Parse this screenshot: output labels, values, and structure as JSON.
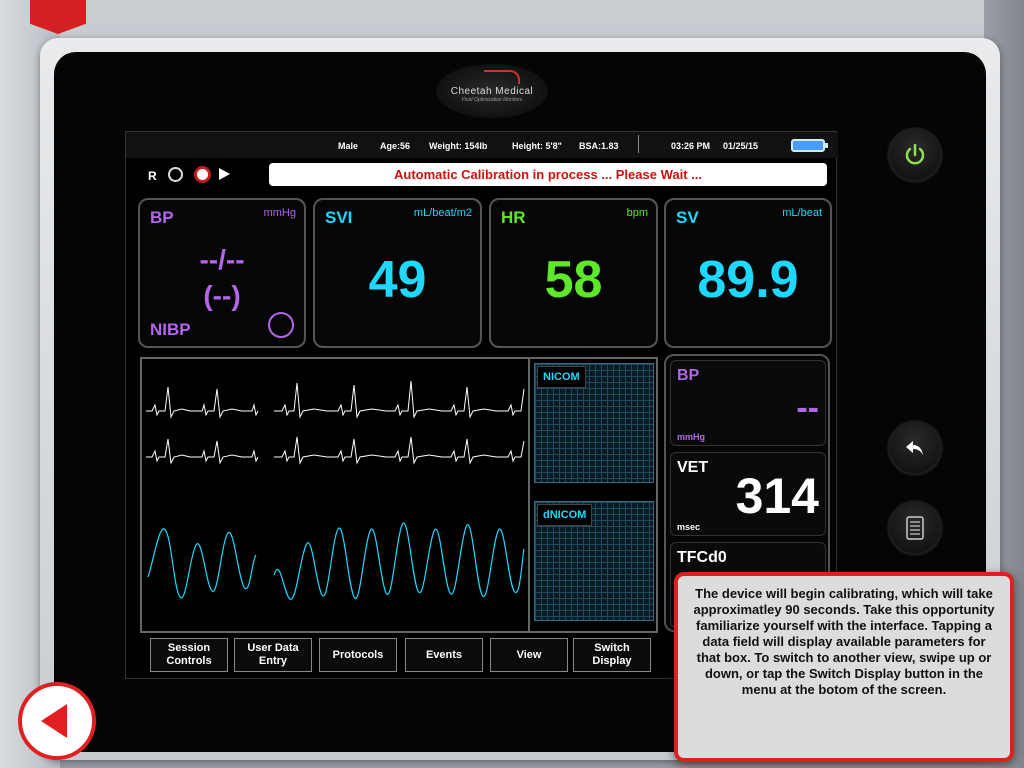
{
  "device": {
    "logo_brand": "Cheetah Medical",
    "logo_tagline": "Fluid Optimization Monitors"
  },
  "header": {
    "gender": "Male",
    "age": "Age:56",
    "weight": "Weight: 154lb",
    "height": "Height: 5'8\"",
    "bsa": "BSA:1.83",
    "time": "03:26 PM",
    "date": "01/25/15"
  },
  "toolbar": {
    "r_label": "R",
    "status_message": "Automatic Calibration in process ... Please Wait ..."
  },
  "tiles": [
    {
      "label": "BP",
      "unit": "mmHg",
      "value": "--/--",
      "sub_value": "(--)",
      "mode": "NIBP",
      "color": "#b266e8"
    },
    {
      "label": "SVI",
      "unit": "mL/beat/m2",
      "value": "49",
      "color": "#1fd8ff"
    },
    {
      "label": "HR",
      "unit": "bpm",
      "value": "58",
      "color": "#5ee82a"
    },
    {
      "label": "SV",
      "unit": "mL/beat",
      "value": "89.9",
      "color": "#1fd8ff"
    }
  ],
  "graphs": {
    "nicom_label": "NICOM",
    "dnicom_label": "dNICOM"
  },
  "side_panel": {
    "bp_label": "BP",
    "bp_value": "--",
    "bp_unit": "mmHg",
    "vet_label": "VET",
    "vet_value": "314",
    "vet_unit": "msec",
    "tfc_label": "TFCd0"
  },
  "menu": [
    {
      "label_line1": "Session",
      "label_line2": "Controls"
    },
    {
      "label_line1": "User Data",
      "label_line2": "Entry"
    },
    {
      "label_line1": "Protocols",
      "label_line2": ""
    },
    {
      "label_line1": "Events",
      "label_line2": ""
    },
    {
      "label_line1": "View",
      "label_line2": ""
    },
    {
      "label_line1": "Switch",
      "label_line2": "Display"
    }
  ],
  "tooltip": {
    "text": "The device will begin calibrating, which will take approximatley 90 seconds.  Take this opportunity familiarize yourself with the interface.  Tapping a data field will display available parameters for that box.  To switch to another view, swipe up or down, or tap the Switch Display button in the menu at the botom of the screen."
  },
  "colors": {
    "accent_red": "#e02020",
    "purple": "#b266e8",
    "cyan": "#1fd8ff",
    "green": "#5ee82a"
  },
  "icons": {
    "power": "power-icon",
    "back": "back-arrow-icon",
    "notes": "notes-icon",
    "nav_back": "left-triangle-icon"
  }
}
